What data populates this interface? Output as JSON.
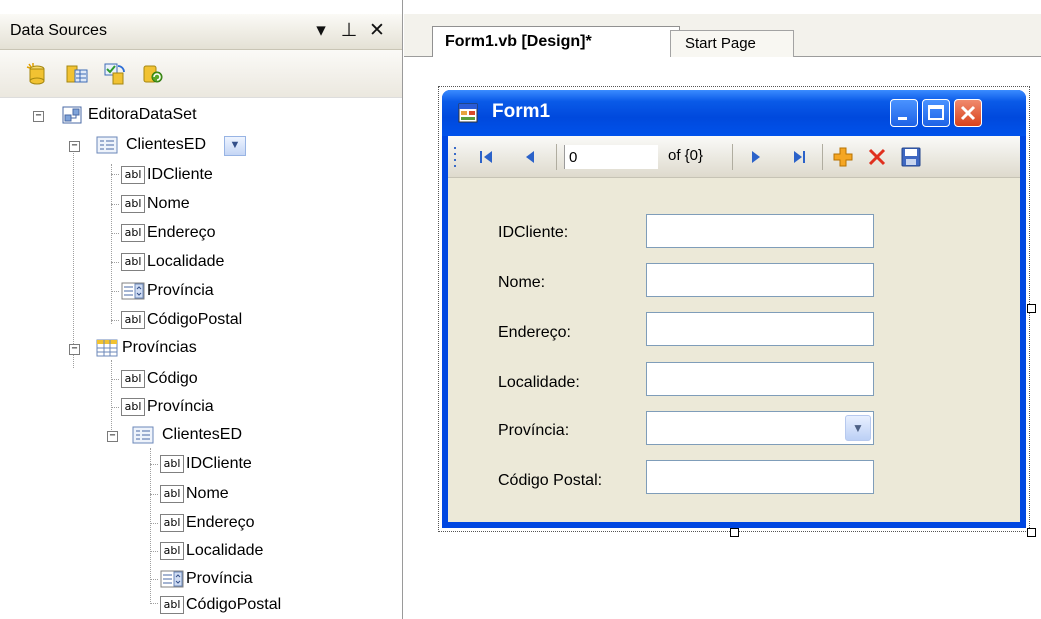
{
  "datasources": {
    "title": "Data Sources",
    "title_buttons": [
      "▾",
      "⊥",
      "✕"
    ],
    "toolbar": [
      "add-new-data-source-icon",
      "edit-dataset-designer-icon",
      "configure-dataset-icon",
      "refresh-icon"
    ],
    "tree": {
      "dataset": "EditoraDataSet",
      "table1": {
        "label": "ClientesED",
        "fields": [
          "IDCliente",
          "Nome",
          "Endereço",
          "Localidade",
          "Província",
          "CódigoPostal"
        ]
      },
      "table2": {
        "label": "Províncias",
        "fields": [
          "Código",
          "Província"
        ],
        "child": {
          "label": "ClientesED",
          "fields": [
            "IDCliente",
            "Nome",
            "Endereço",
            "Localidade",
            "Província",
            "CódigoPostal"
          ]
        }
      },
      "abl": "abl"
    }
  },
  "tabs": {
    "form1": "Form1.vb [Design]*",
    "start": "Start Page"
  },
  "form1": {
    "title": "Form1",
    "navigator": {
      "position": "0",
      "count": "of {0}"
    },
    "fields": {
      "idcliente": "IDCliente:",
      "nome": "Nome:",
      "endereco": "Endereço:",
      "localidade": "Localidade:",
      "provincia": "Província:",
      "codigo_postal": "Código Postal:"
    }
  },
  "colors": {
    "xp_titlebar": "#0047e1",
    "form_background": "#ece9d8",
    "delete_red": "#e0301e",
    "add_orange": "#f5a623"
  }
}
